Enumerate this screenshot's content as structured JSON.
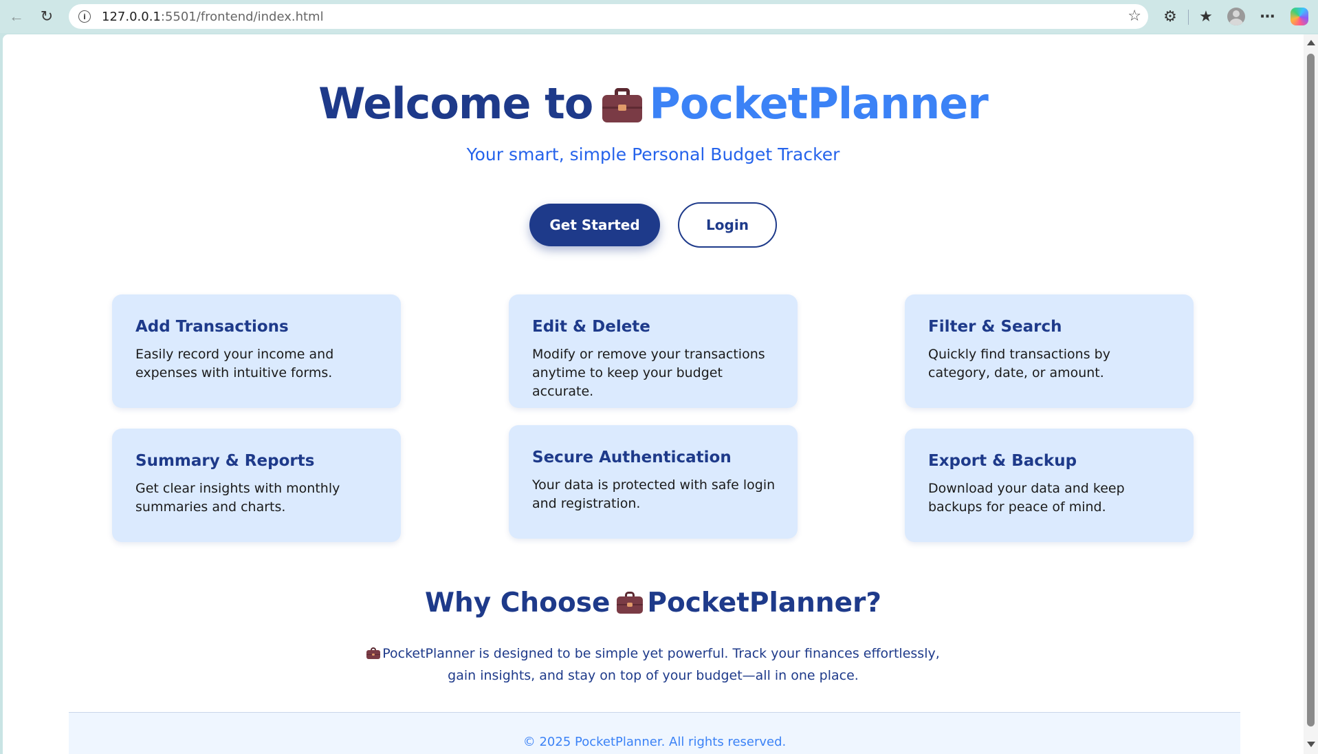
{
  "browser": {
    "url_host": "127.0.0.1",
    "url_rest": ":5501/frontend/index.html"
  },
  "hero": {
    "title_prefix": "Welcome to",
    "title_brand": "PocketPlanner",
    "subtitle": "Your smart, simple Personal Budget Tracker",
    "get_started_label": "Get Started",
    "login_label": "Login"
  },
  "features": [
    {
      "title": "Add Transactions",
      "text": "Easily record your income and expenses with intuitive forms."
    },
    {
      "title": "Edit & Delete",
      "text": "Modify or remove your transactions anytime to keep your budget accurate."
    },
    {
      "title": "Filter & Search",
      "text": "Quickly find transactions by category, date, or amount."
    },
    {
      "title": "Summary & Reports",
      "text": "Get clear insights with monthly summaries and charts."
    },
    {
      "title": "Secure Authentication",
      "text": "Your data is protected with safe login and registration."
    },
    {
      "title": "Export & Backup",
      "text": "Download your data and keep backups for peace of mind."
    }
  ],
  "why": {
    "title_prefix": "Why Choose",
    "title_brand": "PocketPlanner?",
    "text": "PocketPlanner is designed to be simple yet powerful. Track your finances effortlessly, gain insights, and stay on top of your budget—all in one place."
  },
  "footer": {
    "text": "© 2025 PocketPlanner. All rights reserved."
  },
  "colors": {
    "primary": "#1e3a8a",
    "accent": "#3b82f6",
    "card_bg": "#dbeafe"
  }
}
